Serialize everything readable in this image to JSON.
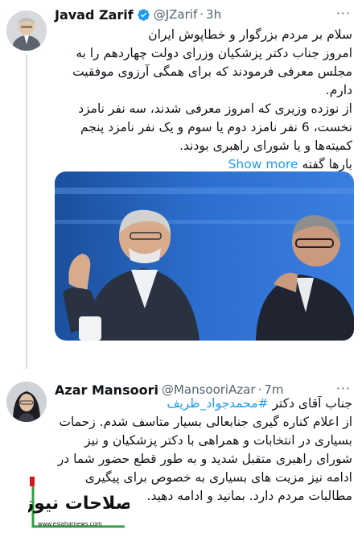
{
  "tweet1": {
    "name": "Javad Zarif",
    "handle": "@JZarif",
    "time": "3h",
    "lines": [
      "سلام بر مردم بزرگوار و خطاپوش ایران",
      "امروز جناب دکتر پزشکیان وزرای دولت چهاردهم را به",
      "مجلس معرفی فرمودند که برای همگی آرزوی موفقیت",
      "دارم.",
      "از نوزده وزیری که امروز معرفی شدند، سه نفر نامزد",
      "نخست، 6 نفر نامزد دوم یا سوم و یک نفر نامزد پنجم",
      "کمیته‌ها و یا شورای راهبری بودند."
    ],
    "last_line": "بارها گفته",
    "show_more": "Show more"
  },
  "tweet2": {
    "name": "Azar Mansoori",
    "handle": "@MansooriAzar",
    "time": "7m",
    "first_line_prefix": "جناب آقای دکتر",
    "mention": "#محمدجواد_ظریف",
    "lines": [
      "از اعلام کناره گیری جنابعالی بسیار متاسف شدم. زحمات",
      "بسیاری در انتخابات و همراهی با دکتر پزشکیان و نیز",
      "شورای راهبری متقبل شدید و به طور قطع حضور شما در",
      "ادامه نیز مزیت های بسیاری به خصوص برای پیگیری",
      "مطالبات مردم دارد. بمانید و ادامه دهید."
    ]
  },
  "watermark": {
    "logo_text": "اصلاحات نیوز",
    "url": "www.eslahatnews.com"
  },
  "colors": {
    "link": "#1d9bf0",
    "text": "#0f1419",
    "muted": "#536471",
    "verified": "#1d9bf0",
    "logo_red": "#d6191f",
    "logo_green": "#2f9e44"
  }
}
